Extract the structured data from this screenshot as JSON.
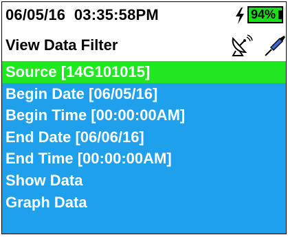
{
  "status": {
    "datetime": "06/05/16  03:35:58PM",
    "battery": "94%"
  },
  "header": {
    "title": "View Data Filter"
  },
  "icons": {
    "charging": "lightning-bolt-icon",
    "satellite": "satellite-dish-icon",
    "probe": "probe-icon"
  },
  "colors": {
    "menu_bg": "#1ea0ec",
    "selected_bg": "#22e622",
    "battery_fill": "#18e018"
  },
  "menu": {
    "items": [
      {
        "label": "Source [14G101015]",
        "selected": true
      },
      {
        "label": "Begin Date [06/05/16]"
      },
      {
        "label": "Begin Time [00:00:00AM]"
      },
      {
        "label": "End Date [06/06/16]"
      },
      {
        "label": "End Time [00:00:00AM]"
      },
      {
        "label": "Show Data"
      },
      {
        "label": "Graph Data"
      }
    ]
  }
}
